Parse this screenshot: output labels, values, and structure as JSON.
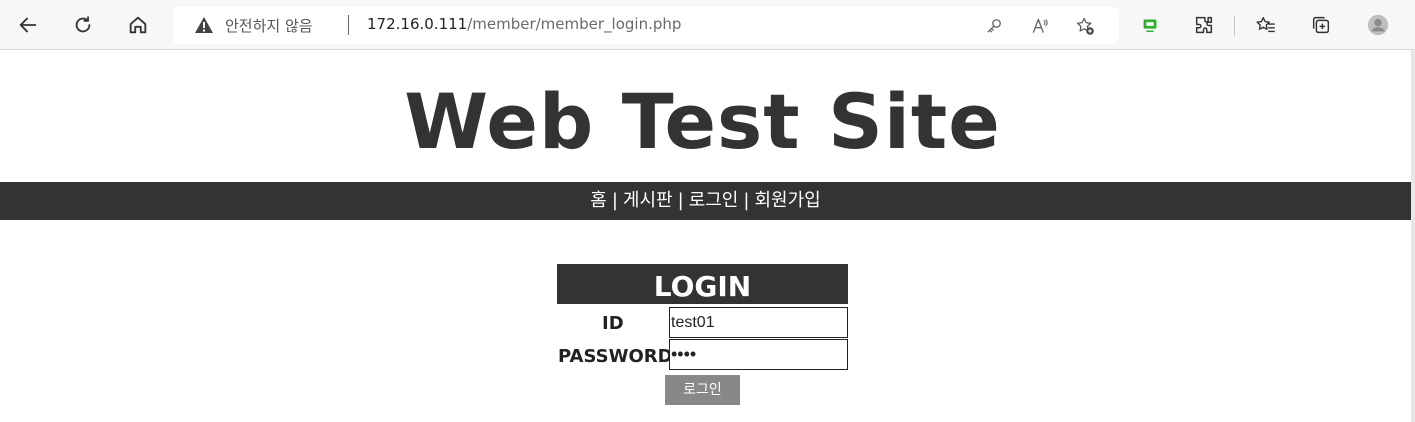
{
  "browser": {
    "security_label": "안전하지 않음",
    "url_host": "172.16.0.111",
    "url_path": "/member/member_login.php",
    "icons": [
      "back-icon",
      "refresh-icon",
      "home-icon",
      "key-icon",
      "read-aloud-icon",
      "favorite-add-icon",
      "screen-cast-icon",
      "extensions-icon",
      "favorites-icon",
      "collections-icon",
      "profile-icon"
    ]
  },
  "site": {
    "title": "Web Test Site",
    "nav": {
      "home": "홈",
      "board": "게시판",
      "login": "로그인",
      "signup": "회원가입",
      "separator": "|"
    }
  },
  "login": {
    "header": "LOGIN",
    "id_label": "ID",
    "id_value": "test01",
    "password_label": "PASSWORD",
    "password_value": "••••",
    "submit_label": "로그인"
  },
  "colors": {
    "dark": "#333333",
    "button": "#888888",
    "accent_green": "#2fb12f"
  }
}
